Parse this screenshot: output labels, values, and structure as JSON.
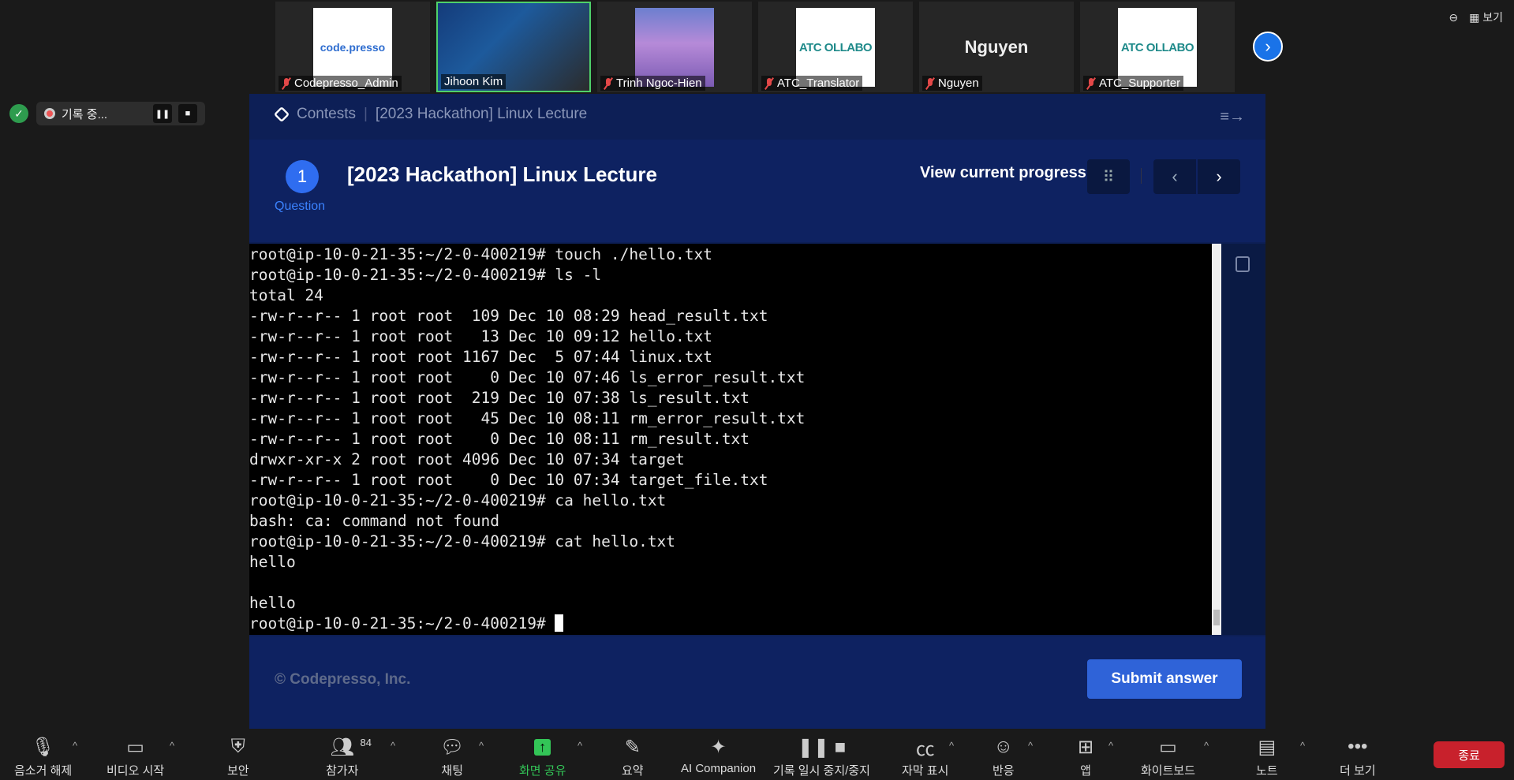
{
  "participants": [
    {
      "name": "Codepresso_Admin",
      "thumb": "code.presso",
      "style": "logo"
    },
    {
      "name": "Jihoon Kim",
      "thumb": "",
      "style": "cam"
    },
    {
      "name": "Trinh Ngoc-Hien",
      "thumb": "",
      "style": "sky"
    },
    {
      "name": "ATC_Translator",
      "thumb": "ATC OLLABO",
      "style": "atc"
    },
    {
      "name": "Nguyen",
      "thumb": "Nguyen",
      "style": "none"
    },
    {
      "name": "ATC_Supporter",
      "thumb": "ATC OLLABO",
      "style": "atc"
    }
  ],
  "view_label": "보기",
  "recording": {
    "label": "기록 중..."
  },
  "contest": {
    "crumb_root": "Contests",
    "crumb_page": "[2023 Hackathon] Linux Lecture",
    "question_number": "1",
    "question_label": "Question",
    "title": "[2023 Hackathon] Linux Lecture",
    "progress_label": "View current progress",
    "copyright": "© Codepresso, Inc.",
    "submit_label": "Submit answer"
  },
  "terminal": {
    "lines": [
      "root@ip-10-0-21-35:~/2-0-400219# touch ./hello.txt",
      "root@ip-10-0-21-35:~/2-0-400219# ls -l",
      "total 24",
      "-rw-r--r-- 1 root root  109 Dec 10 08:29 head_result.txt",
      "-rw-r--r-- 1 root root   13 Dec 10 09:12 hello.txt",
      "-rw-r--r-- 1 root root 1167 Dec  5 07:44 linux.txt",
      "-rw-r--r-- 1 root root    0 Dec 10 07:46 ls_error_result.txt",
      "-rw-r--r-- 1 root root  219 Dec 10 07:38 ls_result.txt",
      "-rw-r--r-- 1 root root   45 Dec 10 08:11 rm_error_result.txt",
      "-rw-r--r-- 1 root root    0 Dec 10 08:11 rm_result.txt",
      "drwxr-xr-x 2 root root 4096 Dec 10 07:34 target",
      "-rw-r--r-- 1 root root    0 Dec 10 07:34 target_file.txt",
      "root@ip-10-0-21-35:~/2-0-400219# ca hello.txt",
      "bash: ca: command not found",
      "root@ip-10-0-21-35:~/2-0-400219# cat hello.txt",
      "hello",
      "",
      "hello"
    ],
    "prompt": "root@ip-10-0-21-35:~/2-0-400219# "
  },
  "toolbar": {
    "unmute": "음소거 해제",
    "video": "비디오 시작",
    "security": "보안",
    "participants": "참가자",
    "participant_count": "84",
    "chat": "채팅",
    "share": "화면 공유",
    "summary": "요약",
    "ai": "AI Companion",
    "record": "기록 일시 중지/중지",
    "captions": "자막 표시",
    "reactions": "반응",
    "apps": "앱",
    "whiteboard": "화이트보드",
    "notes": "노트",
    "more": "더 보기",
    "end": "종료"
  }
}
